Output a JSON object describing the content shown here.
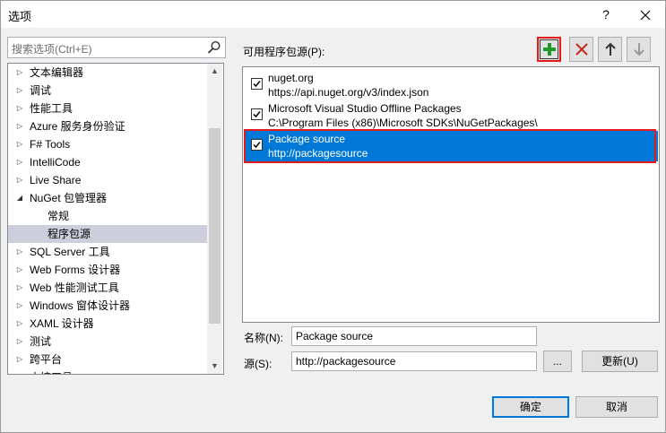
{
  "window": {
    "title": "选项",
    "help_glyph": "?",
    "close_glyph": "✕"
  },
  "search": {
    "placeholder": "搜索选项(Ctrl+E)"
  },
  "tree": {
    "items": [
      {
        "label": "文本编辑器",
        "arrow": "▷",
        "level": 0
      },
      {
        "label": "调试",
        "arrow": "▷",
        "level": 0
      },
      {
        "label": "性能工具",
        "arrow": "▷",
        "level": 0
      },
      {
        "label": "Azure 服务身份验证",
        "arrow": "▷",
        "level": 0
      },
      {
        "label": "F# Tools",
        "arrow": "▷",
        "level": 0
      },
      {
        "label": "IntelliCode",
        "arrow": "▷",
        "level": 0
      },
      {
        "label": "Live Share",
        "arrow": "▷",
        "level": 0
      },
      {
        "label": "NuGet 包管理器",
        "arrow": "◢",
        "level": 0
      },
      {
        "label": "常规",
        "arrow": "",
        "level": 1
      },
      {
        "label": "程序包源",
        "arrow": "",
        "level": 1,
        "selected": true
      },
      {
        "label": "SQL Server 工具",
        "arrow": "▷",
        "level": 0
      },
      {
        "label": "Web Forms 设计器",
        "arrow": "▷",
        "level": 0
      },
      {
        "label": "Web 性能测试工具",
        "arrow": "▷",
        "level": 0
      },
      {
        "label": "Windows 窗体设计器",
        "arrow": "▷",
        "level": 0
      },
      {
        "label": "XAML 设计器",
        "arrow": "▷",
        "level": 0
      },
      {
        "label": "测试",
        "arrow": "▷",
        "level": 0
      },
      {
        "label": "跨平台",
        "arrow": "▷",
        "level": 0
      },
      {
        "label": "中控工具",
        "arrow": "▷",
        "level": 0
      }
    ]
  },
  "sources": {
    "label": "可用程序包源(P):",
    "toolbar": {
      "add": "✚",
      "remove": "✕",
      "up": "🡑",
      "down": "🡓"
    },
    "items": [
      {
        "name": "nuget.org",
        "url": "https://api.nuget.org/v3/index.json",
        "checked": true
      },
      {
        "name": "Microsoft Visual Studio Offline Packages",
        "url": "C:\\Program Files (x86)\\Microsoft SDKs\\NuGetPackages\\",
        "checked": true
      },
      {
        "name": "Package source",
        "url": "http://packagesource",
        "checked": true,
        "selected": true
      }
    ]
  },
  "form": {
    "name_label": "名称(N):",
    "name_value": "Package source",
    "source_label": "源(S):",
    "source_value": "http://packagesource",
    "browse_label": "...",
    "update_label": "更新(U)"
  },
  "footer": {
    "ok_label": "确定",
    "cancel_label": "取消"
  },
  "colors": {
    "selection": "#0078d7",
    "highlight_outline": "#e41b1b",
    "add_icon": "#1e9b28"
  }
}
